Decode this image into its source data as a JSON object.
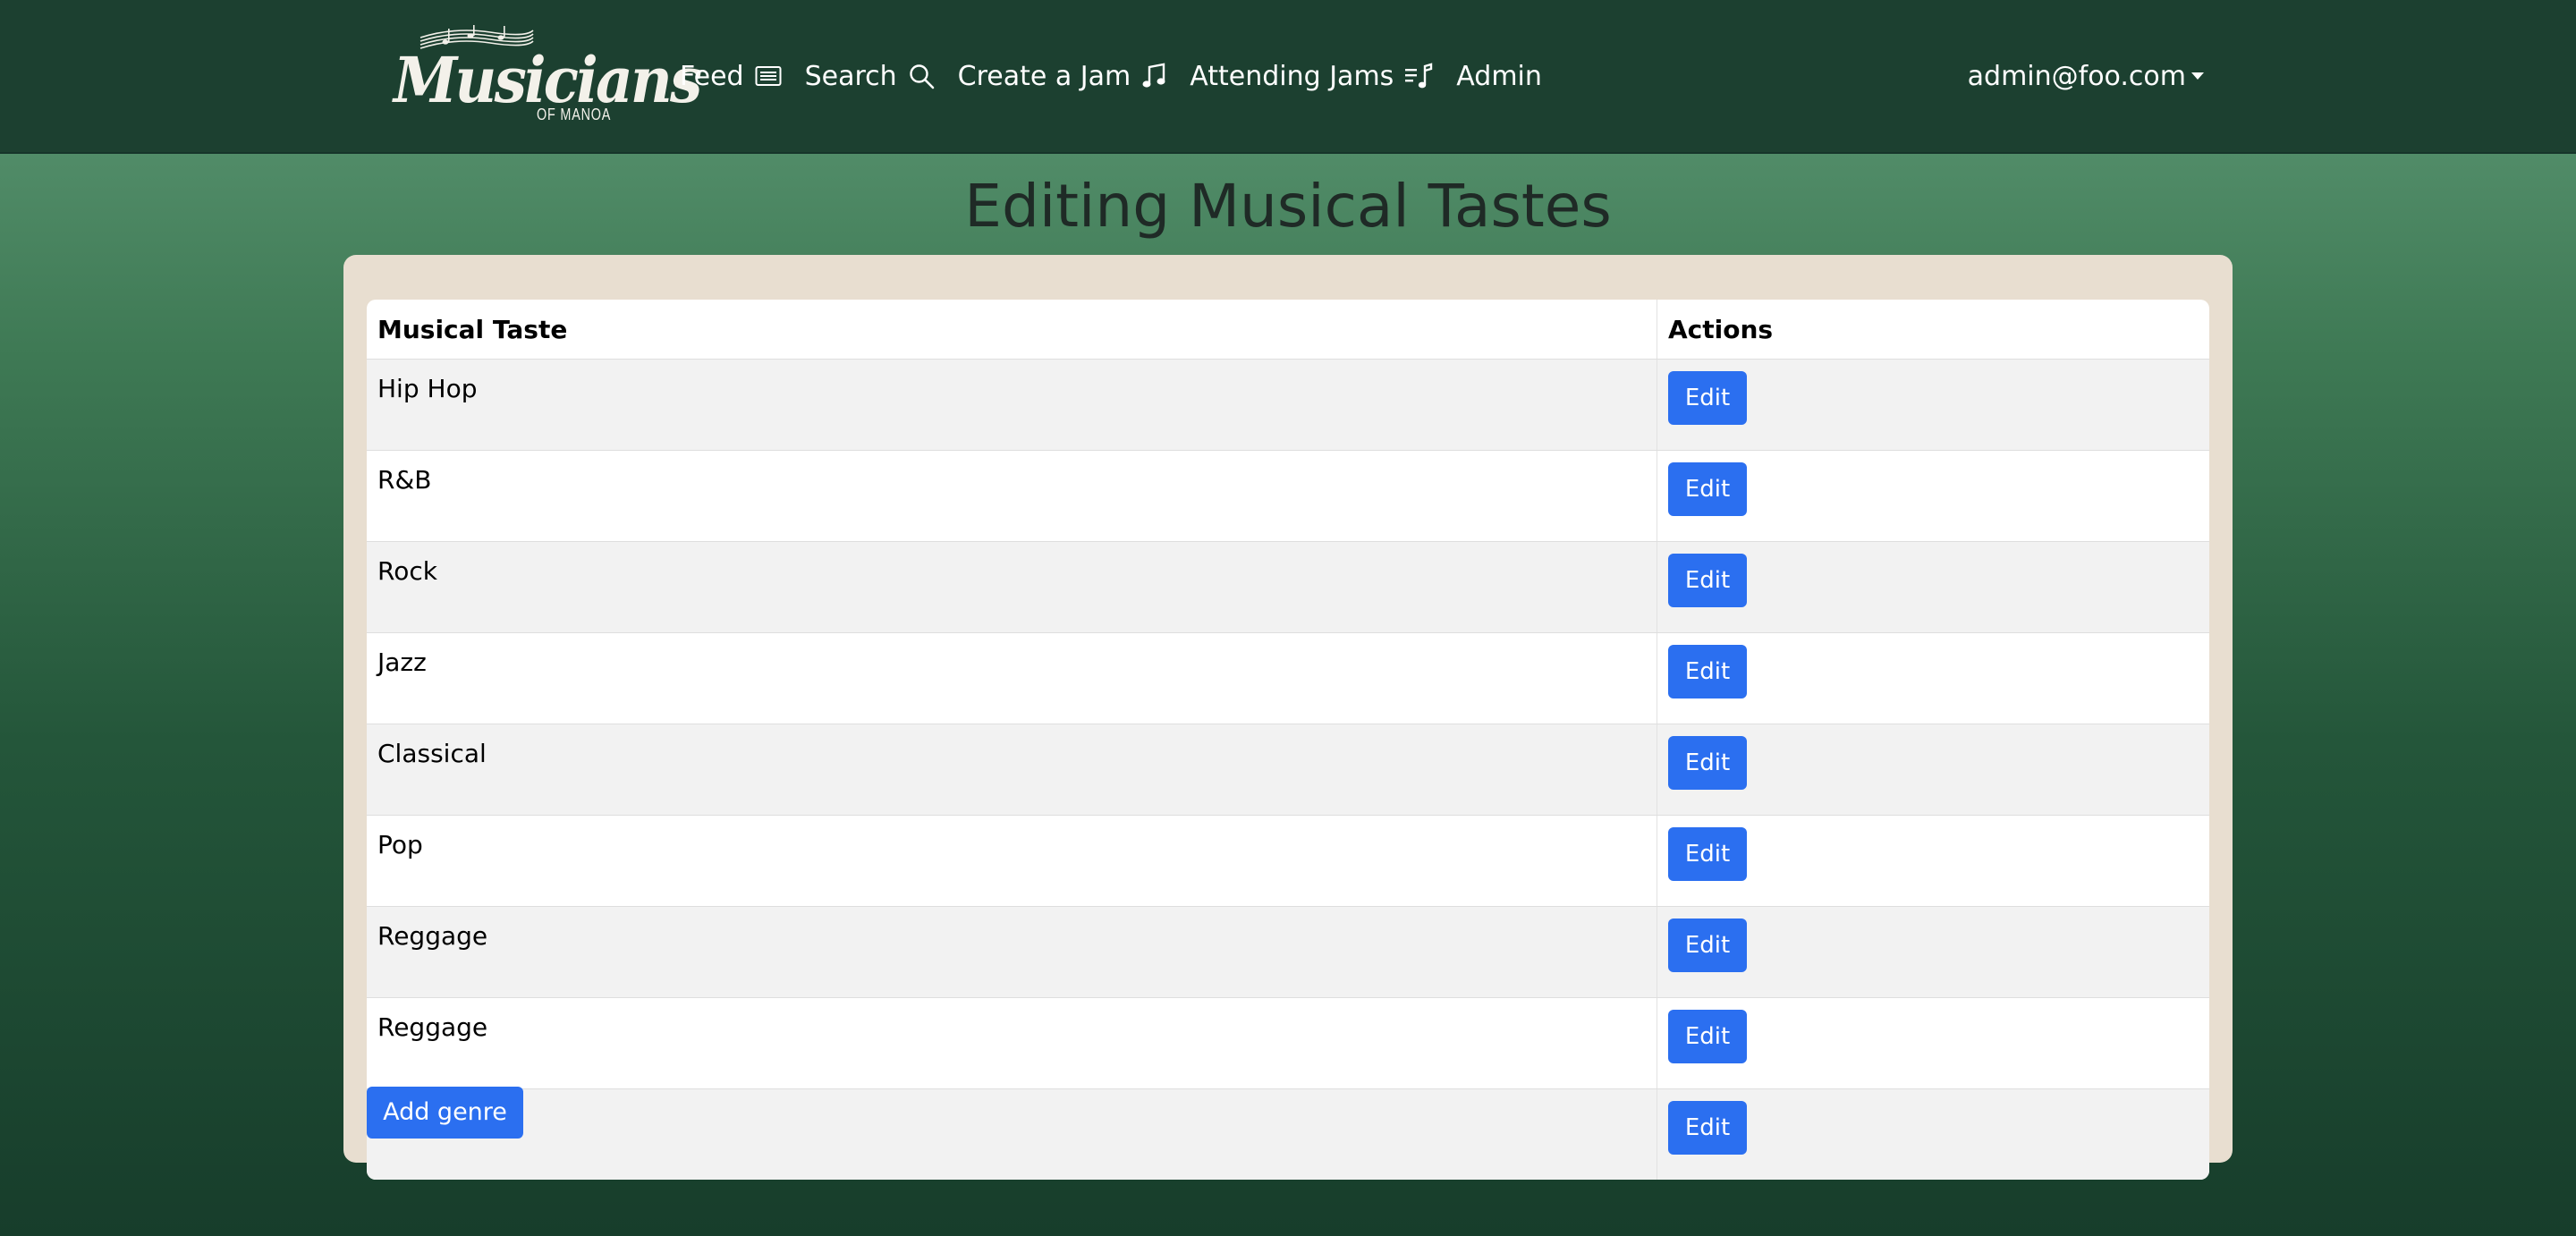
{
  "navbar": {
    "logo": {
      "name": "Musicians",
      "subtitle": "OF MANOA"
    },
    "links": [
      {
        "label": "Feed",
        "icon": "newspaper-icon"
      },
      {
        "label": "Search",
        "icon": "search-icon"
      },
      {
        "label": "Create a Jam",
        "icon": "music-note-icon"
      },
      {
        "label": "Attending Jams",
        "icon": "music-playlist-icon"
      },
      {
        "label": "Admin",
        "icon": ""
      }
    ],
    "user": "admin@foo.com"
  },
  "page": {
    "title": "Editing Musical Tastes"
  },
  "table": {
    "headers": [
      "Musical Taste",
      "Actions"
    ],
    "rows": [
      {
        "taste": "Hip Hop",
        "action": "Edit"
      },
      {
        "taste": "R&B",
        "action": "Edit"
      },
      {
        "taste": "Rock",
        "action": "Edit"
      },
      {
        "taste": "Jazz",
        "action": "Edit"
      },
      {
        "taste": "Classical",
        "action": "Edit"
      },
      {
        "taste": "Pop",
        "action": "Edit"
      },
      {
        "taste": "Reggage",
        "action": "Edit"
      },
      {
        "taste": "Reggage",
        "action": "Edit"
      },
      {
        "taste": "",
        "action": "Edit"
      }
    ]
  },
  "add_button": "Add genre",
  "colors": {
    "navbar": "#1c4030",
    "card": "#e8ded0",
    "primary_button": "#2b6ff0"
  }
}
